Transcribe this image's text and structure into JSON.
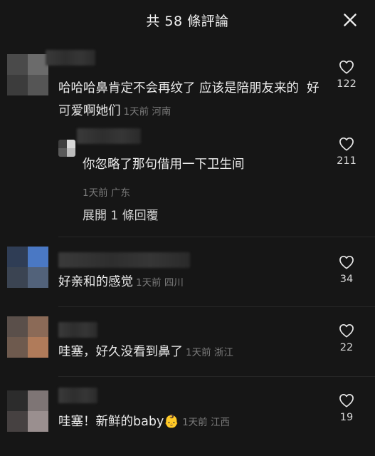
{
  "header": {
    "title": "共 58 條評論"
  },
  "comments": [
    {
      "text": "哈哈哈鼻肯定不会再纹了 应该是陪朋友来的  好可爱啊她们",
      "meta": "1天前 河南",
      "likes": "122",
      "avatar_colors": [
        "#4a4a4a",
        "#6b6b6b",
        "#3c3c3c",
        "#555555"
      ],
      "reply": {
        "text": "你忽略了那句借用一下卫生间",
        "meta": "1天前 广东",
        "likes": "211",
        "avatar_colors": [
          "#3f3f3f",
          "#d9d9d9",
          "#5a5a5a",
          "#bdbdbd"
        ]
      },
      "expand_label": "展開 1 條回覆"
    },
    {
      "text": "好亲和的感觉",
      "meta": "1天前 四川",
      "likes": "34",
      "avatar_colors": [
        "#2f3d55",
        "#4a78c4",
        "#3b4452",
        "#52627a"
      ]
    },
    {
      "text": "哇塞，好久没看到鼻了",
      "meta": "1天前 浙江",
      "likes": "22",
      "avatar_colors": [
        "#5a4f4a",
        "#8b6a57",
        "#6e5a4e",
        "#b07b5a"
      ]
    },
    {
      "text": "哇塞！新鲜的baby",
      "emoji": "👶",
      "meta": "1天前 江西",
      "likes": "19",
      "avatar_colors": [
        "#2c2c2c",
        "#7e7575",
        "#464141",
        "#9a8f8f"
      ]
    }
  ]
}
